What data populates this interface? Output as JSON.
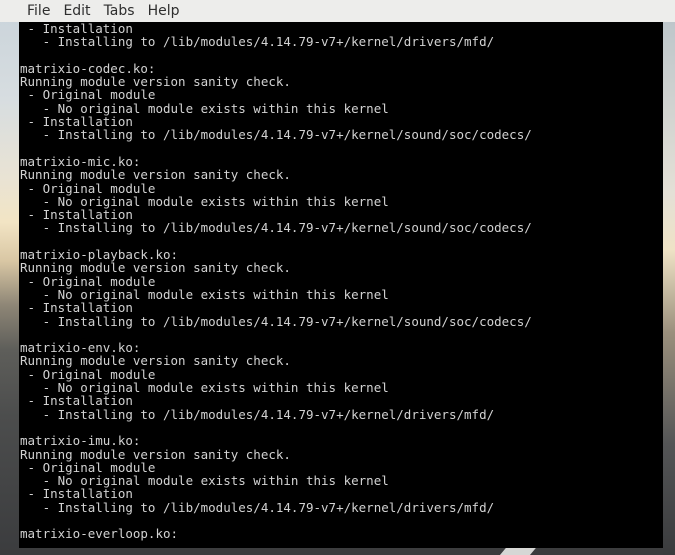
{
  "menubar": {
    "items": [
      "File",
      "Edit",
      "Tabs",
      "Help"
    ]
  },
  "terminal": {
    "lines": [
      " - Installation",
      "   - Installing to /lib/modules/4.14.79-v7+/kernel/drivers/mfd/",
      "",
      "matrixio-codec.ko:",
      "Running module version sanity check.",
      " - Original module",
      "   - No original module exists within this kernel",
      " - Installation",
      "   - Installing to /lib/modules/4.14.79-v7+/kernel/sound/soc/codecs/",
      "",
      "matrixio-mic.ko:",
      "Running module version sanity check.",
      " - Original module",
      "   - No original module exists within this kernel",
      " - Installation",
      "   - Installing to /lib/modules/4.14.79-v7+/kernel/sound/soc/codecs/",
      "",
      "matrixio-playback.ko:",
      "Running module version sanity check.",
      " - Original module",
      "   - No original module exists within this kernel",
      " - Installation",
      "   - Installing to /lib/modules/4.14.79-v7+/kernel/sound/soc/codecs/",
      "",
      "matrixio-env.ko:",
      "Running module version sanity check.",
      " - Original module",
      "   - No original module exists within this kernel",
      " - Installation",
      "   - Installing to /lib/modules/4.14.79-v7+/kernel/drivers/mfd/",
      "",
      "matrixio-imu.ko:",
      "Running module version sanity check.",
      " - Original module",
      "   - No original module exists within this kernel",
      " - Installation",
      "   - Installing to /lib/modules/4.14.79-v7+/kernel/drivers/mfd/",
      "",
      "matrixio-everloop.ko:"
    ]
  }
}
